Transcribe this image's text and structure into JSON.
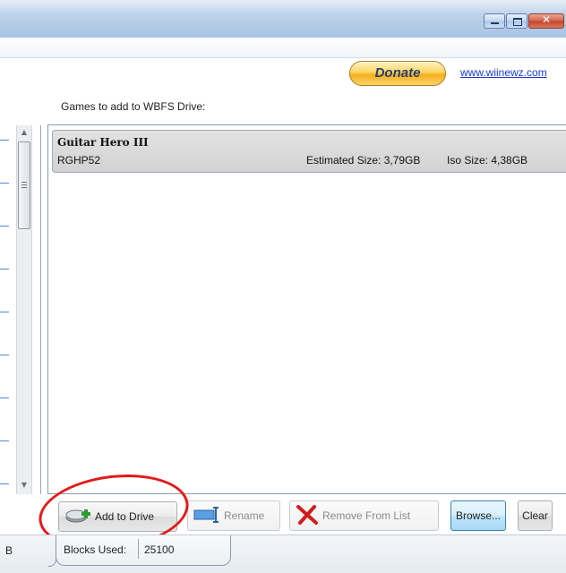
{
  "window": {
    "buttons": [
      "minimize",
      "maximize",
      "close"
    ]
  },
  "header": {
    "donate_label": "Donate",
    "site_link": "www.wiinewz.com"
  },
  "games_panel": {
    "label": "Games to add to WBFS Drive:",
    "items": [
      {
        "title": "Guitar Hero III",
        "id": "RGHP52",
        "estimated_size": "Estimated Size: 3,79GB",
        "iso_size": "Iso Size: 4,38GB"
      }
    ]
  },
  "actions": {
    "add_to_drive": "Add to Drive",
    "rename": "Rename",
    "remove_from_list": "Remove From List",
    "browse": "Browse...",
    "clear": "Clear"
  },
  "status": {
    "left_fragment": "B",
    "blocks_used_label": "Blocks Used:",
    "blocks_used_value": "25100"
  },
  "colors": {
    "highlight_circle": "#e21a1a",
    "link": "#1a3ad0",
    "focus_button": "#3c7fb1"
  }
}
